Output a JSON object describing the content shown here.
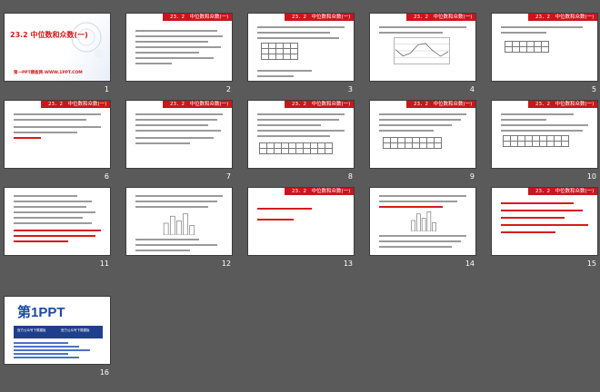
{
  "slides": [
    {
      "number": "1",
      "title": "23.2 中位数和众数(一)",
      "site": "第一PPT模板网-WWW.1PPT.COM"
    },
    {
      "number": "2",
      "header": "23．2　中位数和众数(一)"
    },
    {
      "number": "3",
      "header": "23．2　中位数和众数(一)"
    },
    {
      "number": "4",
      "header": "23．2　中位数和众数(一)"
    },
    {
      "number": "5",
      "header": "23．2　中位数和众数(一)"
    },
    {
      "number": "6",
      "header": "23．2　中位数和众数(一)"
    },
    {
      "number": "7",
      "header": "23．2　中位数和众数(一)"
    },
    {
      "number": "8",
      "header": "23．2　中位数和众数(一)"
    },
    {
      "number": "9",
      "header": "23．2　中位数和众数(一)"
    },
    {
      "number": "10",
      "header": "23．2　中位数和众数(一)"
    },
    {
      "number": "11",
      "header": ""
    },
    {
      "number": "12",
      "header": ""
    },
    {
      "number": "13",
      "header": "23．2　中位数和众数(一)"
    },
    {
      "number": "14",
      "header": ""
    },
    {
      "number": "15",
      "header": "23．2　中位数和众数(一)"
    },
    {
      "number": "16",
      "logo": "第1PPT",
      "band_left": "官方公众号下载模板",
      "band_right": "官方公众号下载模板"
    }
  ],
  "colors": {
    "background": "#5a5a5a",
    "accent": "#c9161c",
    "logo_blue": "#1a4aa0"
  }
}
